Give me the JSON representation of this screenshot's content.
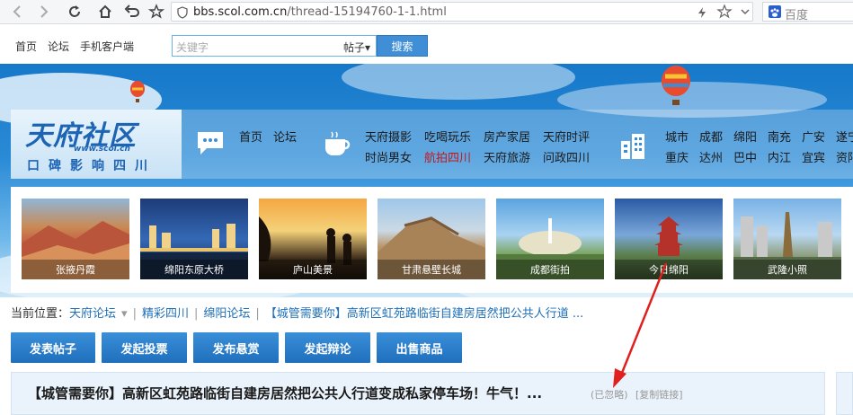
{
  "browser": {
    "url_domain": "bbs.scol.com.cn",
    "url_path": "/thread-15194760-1-1.html",
    "search_engine": "百度"
  },
  "topbar": {
    "links": [
      "首页",
      "论坛",
      "手机客户端"
    ],
    "search_placeholder": "关键字",
    "search_scope": "帖子",
    "search_button": "搜索"
  },
  "logo": {
    "name": "天府社区",
    "url": "www.scol.cn",
    "slogan": "口碑影响四川"
  },
  "nav": {
    "group1": [
      "首页",
      "论坛"
    ],
    "group2_row1": [
      "天府摄影",
      "吃喝玩乐",
      "房产家居",
      "天府时评"
    ],
    "group2_row2": [
      "时尚男女",
      "航拍四川",
      "天府旅游",
      "问政四川"
    ],
    "group3_row1": [
      "城市",
      "成都",
      "绵阳",
      "南充",
      "广安",
      "遂宁"
    ],
    "group3_row2": [
      "重庆",
      "达州",
      "巴中",
      "内江",
      "宜宾",
      "资阳"
    ]
  },
  "thumbs": [
    {
      "caption": "张掖丹霞"
    },
    {
      "caption": "绵阳东原大桥"
    },
    {
      "caption": "庐山美景"
    },
    {
      "caption": "甘肃悬壁长城"
    },
    {
      "caption": "成都街拍"
    },
    {
      "caption": "今日绵阳"
    },
    {
      "caption": "武隆小照"
    }
  ],
  "breadcrumb": {
    "prefix": "当前位置：",
    "items": [
      "天府论坛",
      "精彩四川",
      "绵阳论坛",
      "【城管需要你】高新区虹苑路临街自建房居然把公共人行道 ..."
    ]
  },
  "actions": [
    "发表帖子",
    "发起投票",
    "发布悬赏",
    "发起辩论",
    "出售商品"
  ],
  "thread": {
    "title": "【城管需要你】高新区虹苑路临街自建房居然把公共人行道变成私家停车场！牛气！...",
    "ignored": "(已忽略)",
    "copy_link": "[复制链接]"
  },
  "colors": {
    "link_blue": "#1e6fb8",
    "button_blue": "#2a7dcb",
    "highlight_red": "#c4161c",
    "annotation_red": "#e0201f"
  }
}
